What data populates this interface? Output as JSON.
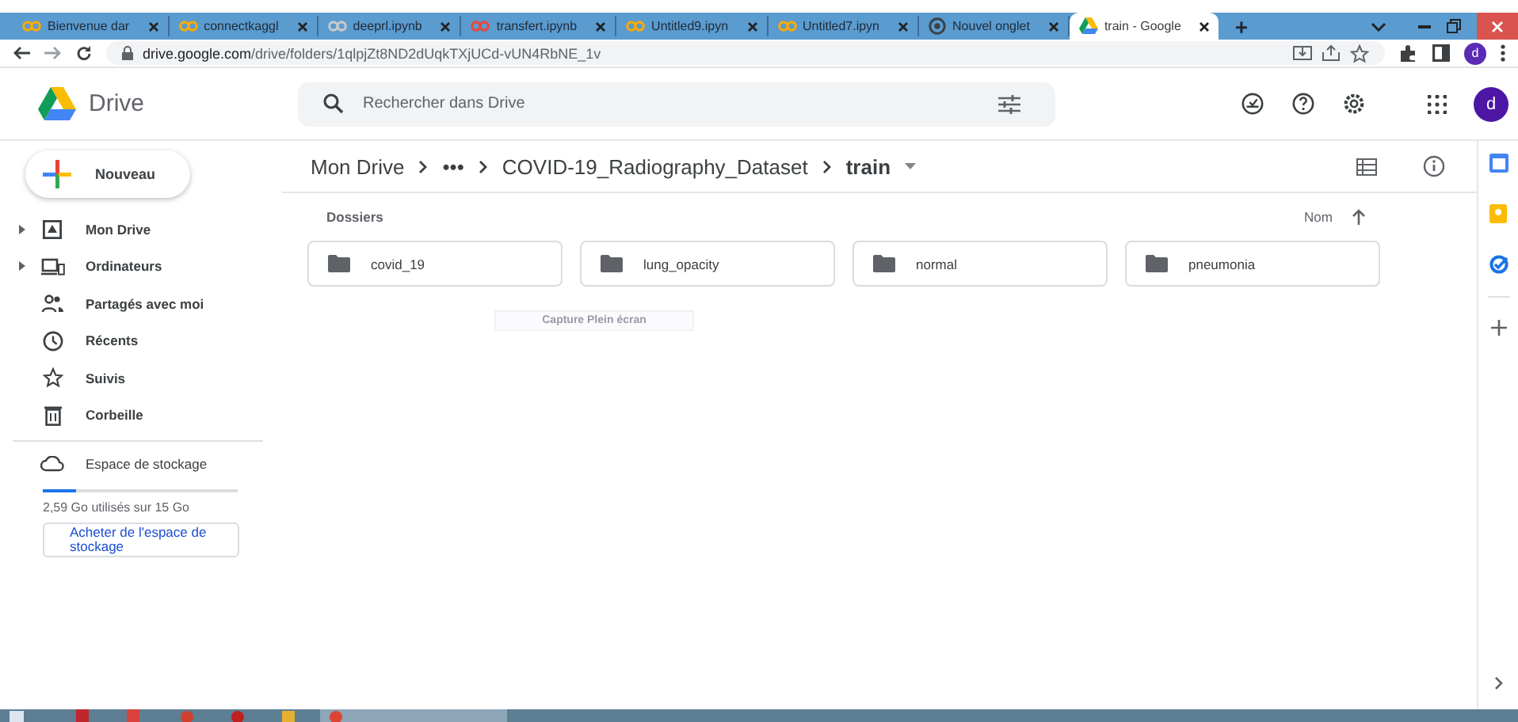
{
  "browser": {
    "tabs": [
      {
        "title": "Bienvenue dar",
        "kind": "notebook",
        "selected": false
      },
      {
        "title": "connectkaggl",
        "kind": "notebook",
        "selected": false
      },
      {
        "title": "deeprl.ipynb",
        "kind": "faded",
        "selected": false
      },
      {
        "title": "transfert.ipynb",
        "kind": "error",
        "selected": false
      },
      {
        "title": "Untitled9.ipyn",
        "kind": "notebook",
        "selected": false
      },
      {
        "title": "Untitled7.ipyn",
        "kind": "notebook",
        "selected": false
      },
      {
        "title": "Nouvel onglet",
        "kind": "browser",
        "selected": false
      },
      {
        "title": "train - Google",
        "kind": "drive",
        "selected": true
      }
    ],
    "new_tab": "+",
    "url_host": "drive.google.com",
    "url_path": "/drive/folders/1qlpjZt8ND2dUqkTXjUCd-vUN4RbNE_1v",
    "profile": "d"
  },
  "header": {
    "app": "Drive",
    "search": {
      "placeholder": "Rechercher dans Drive"
    },
    "avatar": "d"
  },
  "sidebar": {
    "new_button": "Nouveau",
    "items": [
      {
        "label": "Mon Drive",
        "kind": "drive",
        "expandable": true
      },
      {
        "label": "Ordinateurs",
        "kind": "computer",
        "expandable": true
      },
      {
        "label": "Partagés avec moi",
        "kind": "people",
        "expandable": false
      },
      {
        "label": "Récents",
        "kind": "clock",
        "expandable": false
      },
      {
        "label": "Suivis",
        "kind": "star",
        "expandable": false
      },
      {
        "label": "Corbeille",
        "kind": "trash",
        "expandable": false
      }
    ],
    "storage": {
      "label": "Espace de stockage",
      "level": 0.17,
      "usage": "2,59 Go utilisés sur 15 Go",
      "buy": "Acheter de l'espace de stockage"
    }
  },
  "breadcrumb": [
    "Mon Drive",
    "•••",
    "COVID-19_Radiography_Dataset",
    "train"
  ],
  "section": "Dossiers",
  "sort": "Nom",
  "folders": [
    "covid_19",
    "lung_opacity",
    "normal",
    "pneumonia"
  ],
  "tooltip": "Capture Plein écran"
}
